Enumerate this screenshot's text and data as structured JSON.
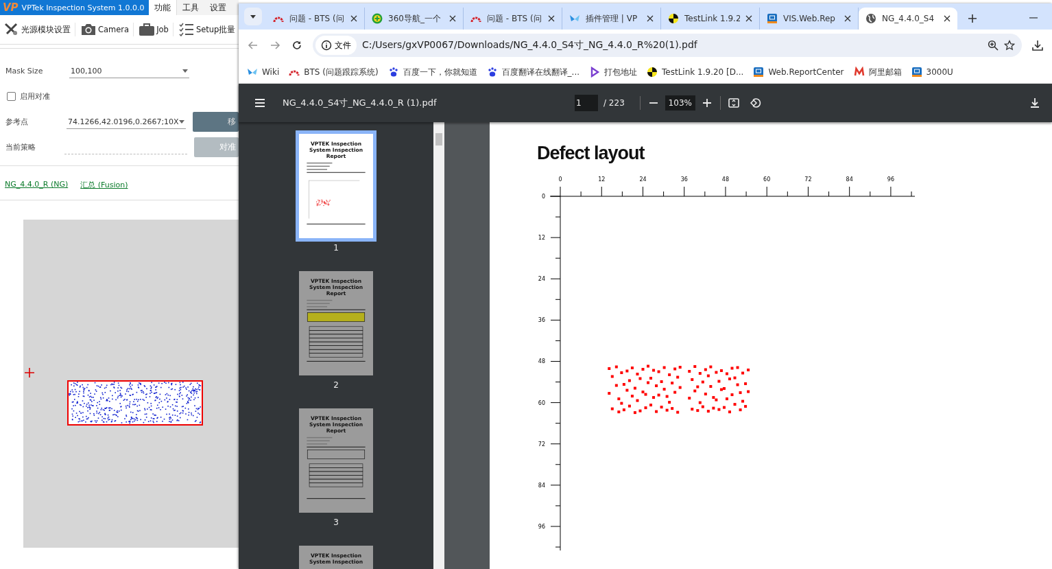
{
  "app": {
    "logo": "VP",
    "title": "VPTek Inspection System 1.0.0.0",
    "menu": [
      {
        "label": "功能",
        "selected": true
      },
      {
        "label": "工具",
        "selected": false
      },
      {
        "label": "设置",
        "selected": false
      }
    ],
    "toolbar": [
      "光源模块设置",
      "Camera",
      "Job",
      "Setup批量"
    ],
    "form": {
      "mask_size": {
        "label": "Mask Size",
        "value": "100,100"
      },
      "enable_align": {
        "label": "启用对准",
        "checked": false
      },
      "reference": {
        "label": "参考点",
        "value": "74.1266,42.0196,0.2667;10X",
        "button": "移",
        "button_disabled": false
      },
      "strategy": {
        "label": "当前策略",
        "button": "对准",
        "button_disabled": true
      }
    },
    "links": [
      "NG_4.4.0_R (NG)",
      "汇总 (Fusion)"
    ]
  },
  "browser": {
    "tabs": [
      {
        "title": "问题 - BTS (问",
        "selected": false
      },
      {
        "title": "360导航_一个",
        "selected": false
      },
      {
        "title": "问题 - BTS (问",
        "selected": false
      },
      {
        "title": "插件管理 | VP",
        "selected": false
      },
      {
        "title": "TestLink 1.9.2",
        "selected": false
      },
      {
        "title": "VIS.Web.Rep",
        "selected": false
      },
      {
        "title": "NG_4.4.0_S4",
        "selected": true
      }
    ],
    "address": {
      "security_label": "文件",
      "url": "C:/Users/gxVP0067/Downloads/NG_4.4.0_S4寸_NG_4.4.0_R%20(1).pdf"
    },
    "bookmarks": [
      "Wiki",
      "BTS (问题跟踪系统)",
      "百度一下，你就知道",
      "百度翻译在线翻译_...",
      "打包地址",
      "TestLink 1.9.20 [D...",
      "Web.ReportCenter",
      "阿里邮箱",
      "3000U"
    ],
    "pdf": {
      "filename": "NG_4.4.0_S4寸_NG_4.4.0_R (1).pdf",
      "page": "1",
      "page_count": "/ 223",
      "zoom": "103%",
      "thumbnails": [
        {
          "label": "1",
          "selected": true,
          "title": "VPTEK Inspection System Inspection Report"
        },
        {
          "label": "2",
          "selected": false,
          "title": "VPTEK Inspection System Inspection Report"
        },
        {
          "label": "3",
          "selected": false,
          "title": "VPTEK Inspection System Inspection Report"
        },
        {
          "title": "VPTEK Inspection System Inspection",
          "selected": false
        }
      ],
      "page_heading": "Defect layout",
      "chart_data": {
        "type": "scatter",
        "xlim": [
          0,
          103
        ],
        "ylim": [
          103,
          0
        ],
        "xticks": [
          0,
          12,
          24,
          36,
          48,
          60,
          72,
          84,
          96
        ],
        "yticks": [
          0,
          12,
          24,
          36,
          48,
          60,
          72,
          84,
          96
        ],
        "x": [
          14.2,
          14.2,
          15.1,
          15.1,
          16.3,
          16.3,
          17.0,
          17.0,
          17.8,
          17.8,
          18.5,
          18.5,
          19.4,
          19.4,
          20.1,
          20.1,
          20.9,
          20.9,
          21.7,
          21.7,
          22.4,
          22.4,
          23.2,
          23.2,
          24.0,
          24.0,
          24.8,
          24.8,
          25.5,
          25.5,
          26.3,
          26.3,
          27.1,
          27.1,
          27.9,
          27.9,
          28.6,
          28.6,
          29.4,
          29.4,
          30.2,
          30.2,
          31.0,
          31.0,
          31.7,
          31.7,
          32.5,
          32.5,
          33.3,
          33.3,
          34.1,
          34.1,
          34.8,
          34.8,
          37.5,
          37.5,
          38.3,
          38.3,
          39.1,
          39.1,
          39.9,
          39.9,
          40.6,
          40.6,
          41.4,
          41.4,
          42.2,
          42.2,
          43.0,
          43.0,
          43.7,
          43.7,
          44.5,
          44.5,
          45.3,
          45.3,
          46.1,
          46.1,
          46.8,
          46.8,
          47.6,
          47.6,
          48.4,
          48.4,
          49.2,
          49.2,
          49.9,
          49.9,
          50.7,
          50.7,
          51.5,
          51.5,
          52.3,
          52.3,
          53.0,
          53.0,
          53.8,
          53.8,
          54.6,
          54.6
        ],
        "series": [
          {
            "color": "#ff0000",
            "values": [
              50.1,
              57.3,
              52.4,
              61.8,
              49.6,
              55.0,
              58.9,
              62.7,
              51.3,
              60.2,
              54.7,
              62.1,
              50.8,
              56.4,
              53.6,
              61.0,
              49.9,
              58.1,
              55.8,
              62.9,
              51.7,
              59.4,
              53.0,
              62.4,
              50.3,
              56.9,
              57.6,
              61.5,
              49.4,
              54.2,
              52.9,
              60.7,
              50.6,
              58.5,
              55.1,
              62.6,
              51.0,
              57.8,
              53.9,
              61.3,
              49.8,
              56.1,
              58.2,
              62.2,
              51.9,
              59.9,
              54.3,
              61.7,
              50.2,
              57.0,
              52.6,
              62.8,
              49.7,
              55.6,
              50.9,
              58.7,
              53.3,
              61.9,
              49.5,
              56.6,
              55.4,
              62.3,
              51.5,
              60.0,
              54.0,
              61.2,
              50.4,
              57.5,
              52.2,
              62.5,
              49.6,
              55.3,
              58.5,
              61.6,
              51.2,
              59.2,
              53.8,
              62.0,
              50.7,
              56.2,
              55.9,
              61.4,
              51.6,
              58.9,
              53.1,
              62.7,
              50.0,
              57.7,
              52.8,
              60.5,
              49.8,
              54.8,
              57.1,
              62.1,
              51.4,
              59.6,
              54.5,
              61.1,
              50.5,
              56.8
            ]
          }
        ]
      }
    }
  }
}
